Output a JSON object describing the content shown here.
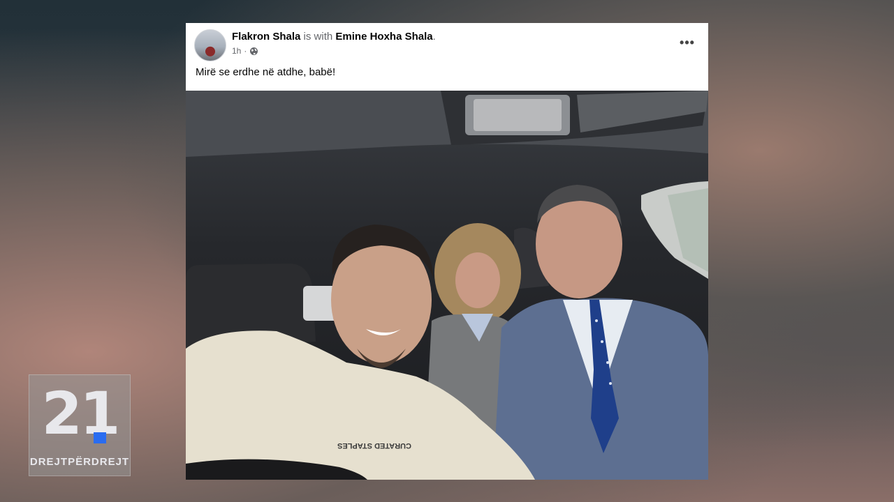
{
  "post": {
    "author": "Flakron Shala",
    "connector": "is with",
    "tagged": "Emine Hoxha Shala",
    "tagged_suffix": ".",
    "time": "1h",
    "time_separator": "·",
    "privacy_icon": "globe-icon",
    "more_icon": "more-options-icon",
    "more_label": "•••",
    "text": "Mirë se erdhe në atdhe, babë!",
    "photo_shirt_text": "CURATED STAPLES"
  },
  "channel_logo": {
    "number": "21",
    "slogan": "DREJTPËRDREJT",
    "accent_color": "#2a6cf0"
  }
}
